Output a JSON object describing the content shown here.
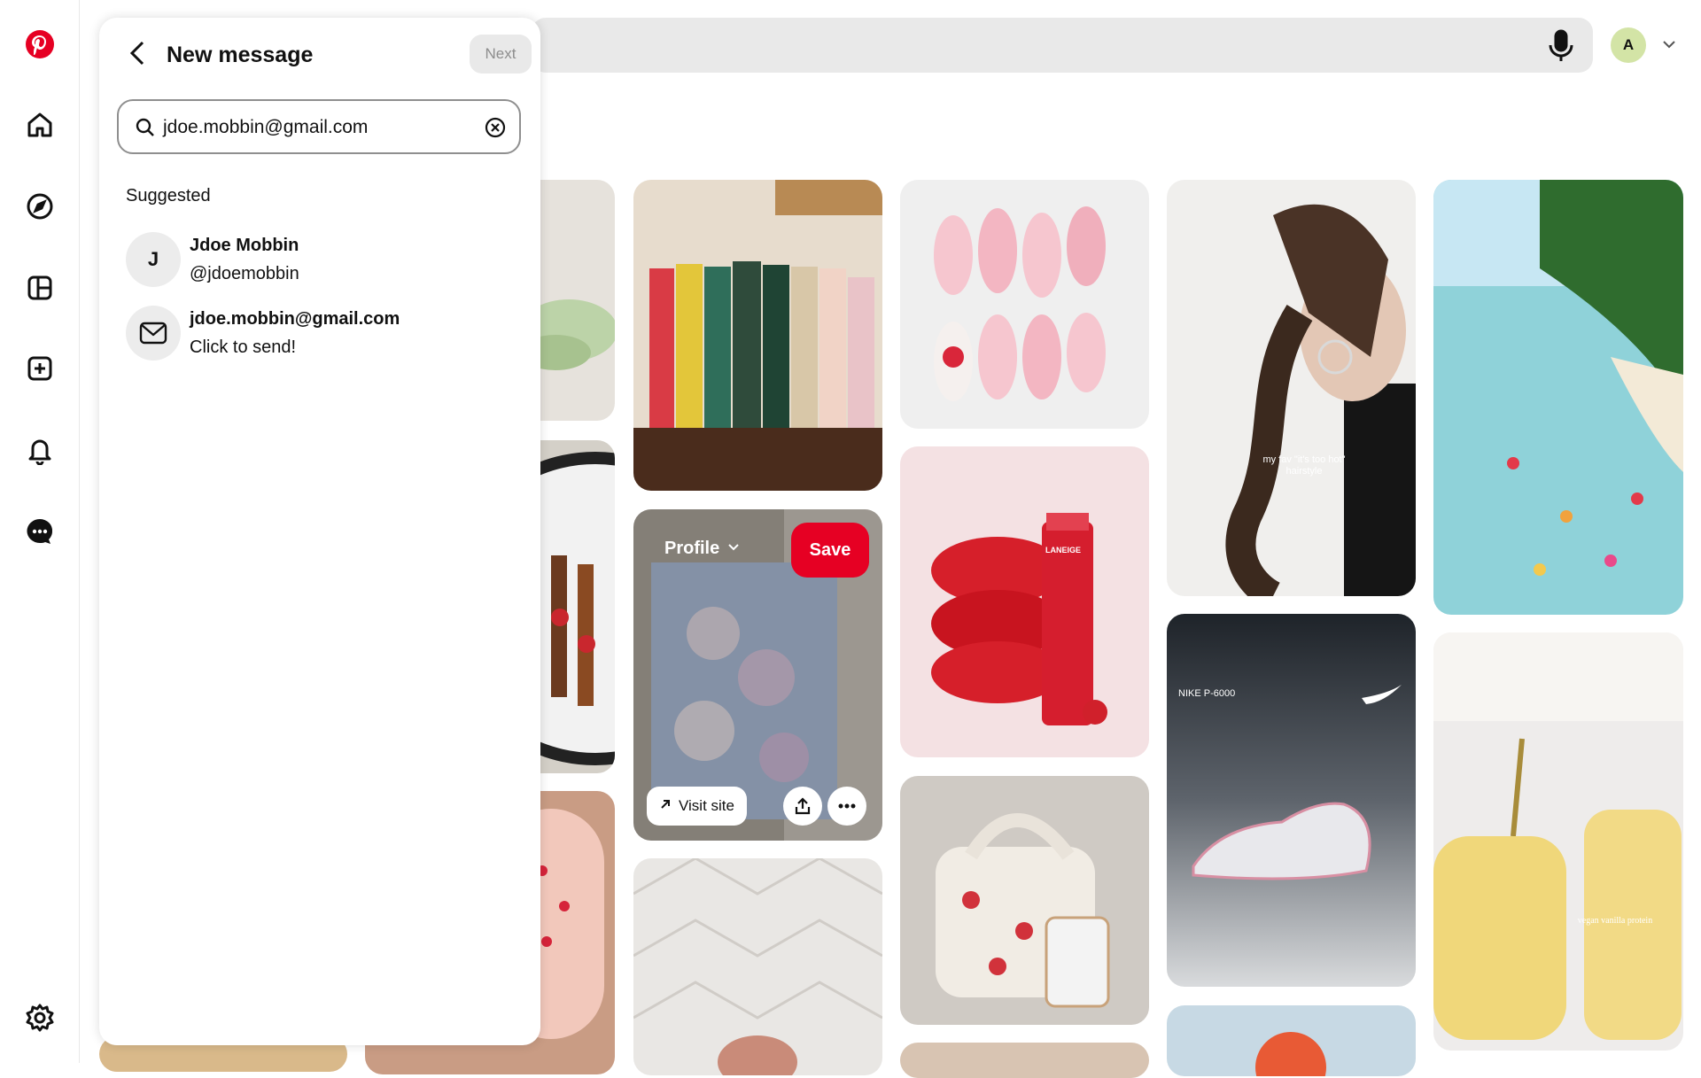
{
  "nav": {
    "items": [
      "pinterest-logo",
      "home",
      "explore",
      "boards",
      "create",
      "notifications",
      "messages",
      "settings"
    ]
  },
  "header": {
    "avatar_initial": "A"
  },
  "panel": {
    "title": "New message",
    "next_label": "Next",
    "search_value": "jdoe.mobbin@gmail.com",
    "suggested_heading": "Suggested",
    "suggestions": [
      {
        "avatar": "J",
        "primary": "Jdoe Mobbin",
        "secondary": "@jdoemobbin"
      },
      {
        "avatar": "mail-icon",
        "primary": "jdoe.mobbin@gmail.com",
        "secondary": "Click to send!"
      }
    ]
  },
  "pin_overlay": {
    "profile_label": "Profile",
    "save_label": "Save",
    "visit_label": "Visit site"
  },
  "pin_text": {
    "hairstyle_caption_1": "my fav \"it's too hot\"",
    "hairstyle_caption_2": "hairstyle",
    "shoe_caption": "NIKE P-6000",
    "smoothie_caption": "vegan vanilla protein",
    "lipstick_brand": "LANEIGE"
  },
  "colors": {
    "brand": "#e60023",
    "search_bg": "#e9e9e9",
    "avatar_bg": "#d3e4a6"
  }
}
